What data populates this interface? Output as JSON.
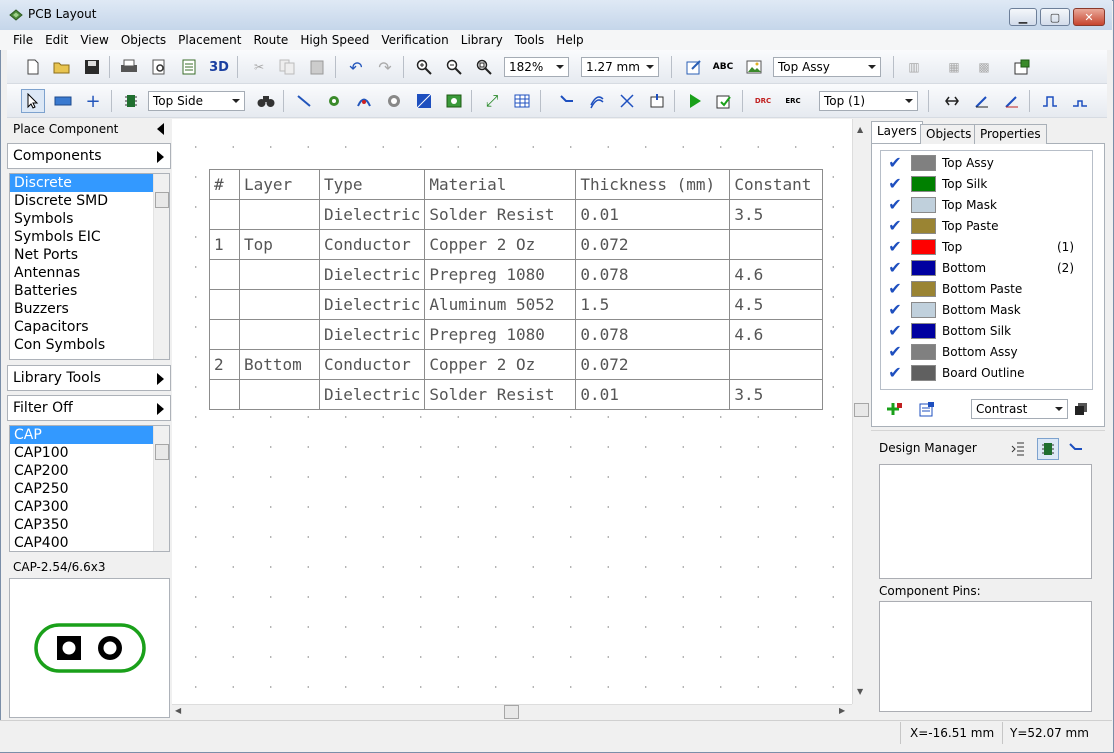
{
  "window": {
    "title": "PCB Layout",
    "minimize": "▁",
    "maximize": "▢",
    "close": "✕"
  },
  "menu": [
    "File",
    "Edit",
    "View",
    "Objects",
    "Placement",
    "Route",
    "High Speed",
    "Verification",
    "Library",
    "Tools",
    "Help"
  ],
  "toolbar1": {
    "zoom": "182%",
    "grid": "1.27 mm",
    "view_layer": "Top Assy"
  },
  "toolbar2": {
    "side": "Top Side",
    "layer": "Top (1)"
  },
  "left_panel": {
    "header": "Place Component",
    "components_btn": "Components",
    "component_list": [
      "Discrete",
      "Discrete SMD",
      "Symbols",
      "Symbols EIC",
      "Net Ports",
      "Antennas",
      "Batteries",
      "Buzzers",
      "Capacitors",
      "Con Symbols"
    ],
    "library_tools_btn": "Library Tools",
    "filter_btn": "Filter Off",
    "part_list": [
      "CAP",
      "CAP100",
      "CAP200",
      "CAP250",
      "CAP300",
      "CAP350",
      "CAP400"
    ],
    "footprint_name": "CAP-2.54/6.6x3"
  },
  "stackup": {
    "headers": [
      "#",
      "Layer",
      "Type",
      "Material",
      "Thickness (mm)",
      "Constant"
    ],
    "rows": [
      [
        "",
        "",
        "Dielectric",
        "Solder Resist",
        "0.01",
        "3.5"
      ],
      [
        "1",
        "Top",
        "Conductor",
        "Copper 2 Oz",
        "0.072",
        ""
      ],
      [
        "",
        "",
        "Dielectric",
        "Prepreg 1080",
        "0.078",
        "4.6"
      ],
      [
        "",
        "",
        "Dielectric",
        "Aluminum 5052",
        "1.5",
        "4.5"
      ],
      [
        "",
        "",
        "Dielectric",
        "Prepreg 1080",
        "0.078",
        "4.6"
      ],
      [
        "2",
        "Bottom",
        "Conductor",
        "Copper 2 Oz",
        "0.072",
        ""
      ],
      [
        "",
        "",
        "Dielectric",
        "Solder Resist",
        "0.01",
        "3.5"
      ]
    ]
  },
  "right_panel": {
    "tabs": [
      "Layers",
      "Objects",
      "Properties"
    ],
    "layers": [
      {
        "name": "Top Assy",
        "color": "#808080",
        "num": ""
      },
      {
        "name": "Top Silk",
        "color": "#008000",
        "num": ""
      },
      {
        "name": "Top Mask",
        "color": "#c0d0dc",
        "num": ""
      },
      {
        "name": "Top Paste",
        "color": "#9a8433",
        "num": ""
      },
      {
        "name": "Top",
        "color": "#ff0000",
        "num": "(1)"
      },
      {
        "name": "Bottom",
        "color": "#0000a0",
        "num": "(2)"
      },
      {
        "name": "Bottom Paste",
        "color": "#9a8433",
        "num": ""
      },
      {
        "name": "Bottom Mask",
        "color": "#c0d0dc",
        "num": ""
      },
      {
        "name": "Bottom Silk",
        "color": "#0000a0",
        "num": ""
      },
      {
        "name": "Bottom Assy",
        "color": "#808080",
        "num": ""
      },
      {
        "name": "Board Outline",
        "color": "#606060",
        "num": ""
      }
    ],
    "contrast": "Contrast",
    "design_manager": "Design Manager",
    "component_pins": "Component Pins:"
  },
  "status": {
    "x": "X=-16.51 mm",
    "y": "Y=52.07 mm"
  }
}
